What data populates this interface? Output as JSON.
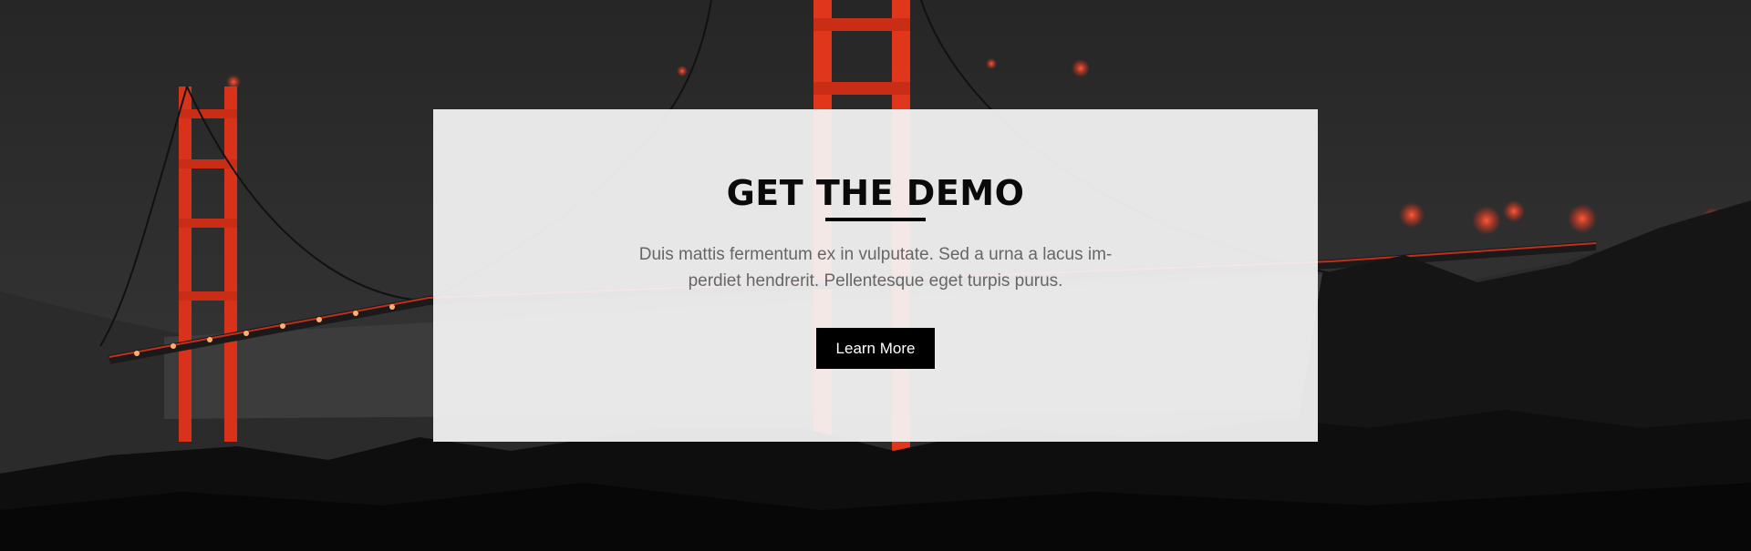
{
  "hero": {
    "title": "GET THE DEMO",
    "description": "Duis mattis fermentum ex in vulputate. Sed a urna a lacus im- perdiet hendrerit. Pellentesque eget turpis purus.",
    "button_label": "Learn More"
  },
  "colors": {
    "card_background": "#f5f5f5",
    "title": "#0a0a0a",
    "description": "#666666",
    "button_background": "#000000",
    "button_text": "#ffffff",
    "bridge_accent": "#e8341c"
  }
}
